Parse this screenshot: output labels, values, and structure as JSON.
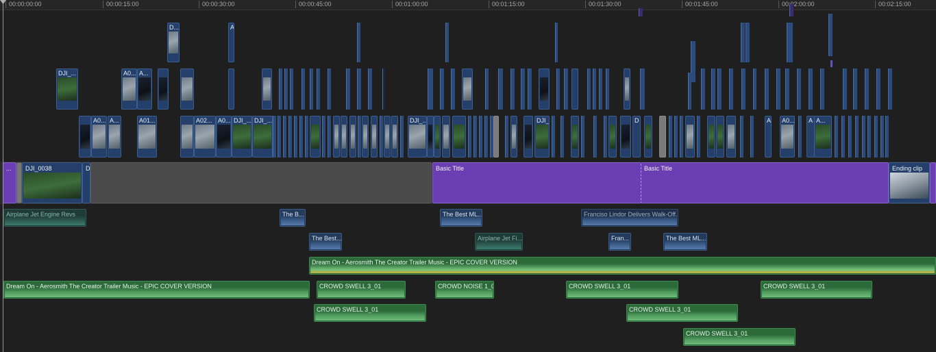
{
  "ruler": {
    "ticks": [
      "00:00:00:00",
      "00:00:15:00",
      "00:00:30:00",
      "00:00:45:00",
      "00:01:00:00",
      "00:01:15:00",
      "00:01:30:00",
      "00:01:45:00",
      "00:02:00:00",
      "00:02:15:00"
    ]
  },
  "connected_video_labels": {
    "d1": "D...",
    "a1": "A",
    "dji1": "DJI_...",
    "a01": "A0...",
    "a02": "A...",
    "a03": "A0...",
    "a04": "A...",
    "a05": "A01...",
    "a06": "A02...",
    "a07": "A0...",
    "dji2": "DJI_...",
    "dji3": "DJI_...",
    "dji4": "DJI_...",
    "dji5": "DJI_",
    "d2": "D",
    "a08": "A",
    "a09": "A",
    "a10": "A0...",
    "a11": "A..."
  },
  "primary": {
    "clip1": "...",
    "clip2": "DJI_0038",
    "clip3": "D",
    "title1": "Basic Title",
    "title2": "Basic Title",
    "ending": "Ending clip"
  },
  "audio": {
    "jet1": "Airplane Jet Engine Revs",
    "theb": "The B...",
    "best1": "The Best ML...",
    "lindor": "Franciso Lindor Delivers Walk-Off...",
    "best2": "The Best...",
    "jet2": "Airplane Jet Fi...",
    "fran": "Fran...",
    "best3": "The Best ML...",
    "music2": "Dream On - Aerosmith  The Creator Trailer Music - EPIC COVER VERSION",
    "music1": "Dream On - Aerosmith  The Creator Trailer Music - EPIC COVER VERSION",
    "crowd1": "CROWD SWELL 3_01",
    "noise1": "CROWD NOISE 1_01",
    "crowd2": "CROWD SWELL 3_01",
    "crowd3": "CROWD SWELL 3_01",
    "crowd4": "CROWD SWELL 3_01",
    "crowd5": "CROWD SWELL 3_01",
    "crowd6": "CROWD SWELL 3_01"
  },
  "colors": {
    "title_purple": "#6b3fb3",
    "video_blue": "#24406a",
    "music_green": "#2c6a3a",
    "dialog_blue": "#243b5c"
  }
}
